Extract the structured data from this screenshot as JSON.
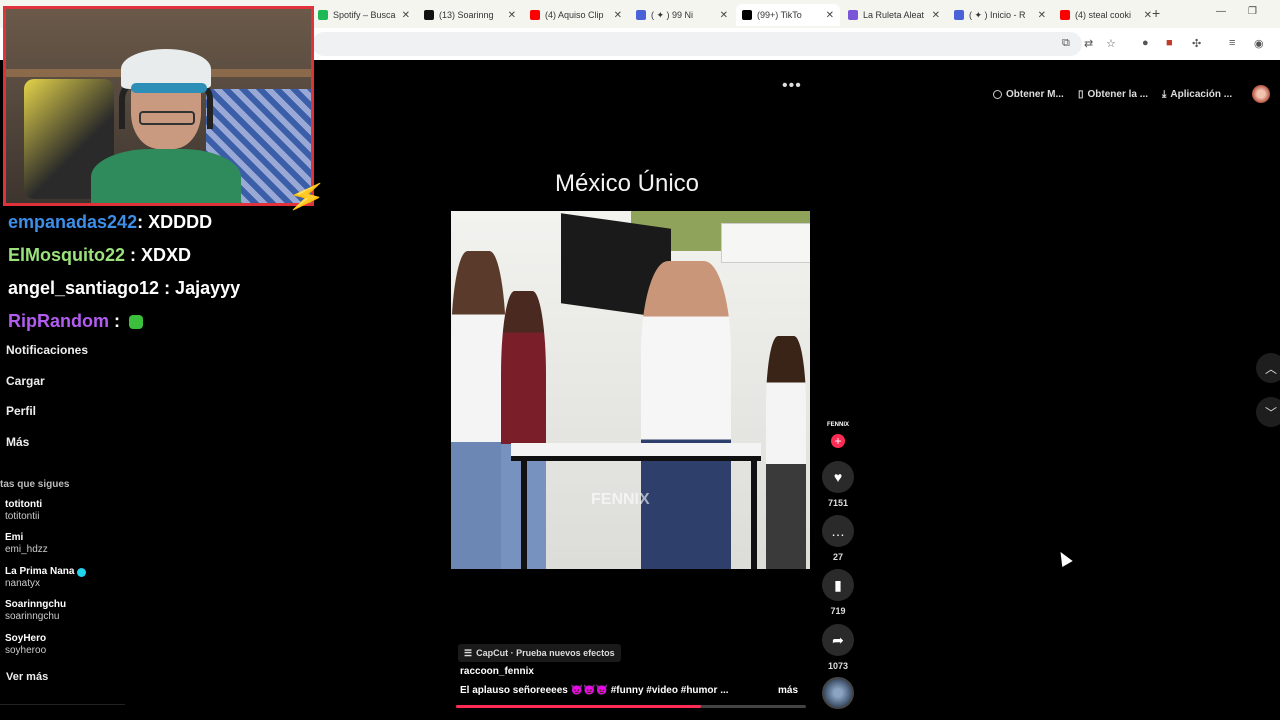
{
  "browser": {
    "tabs": [
      {
        "title": "Spotify – Busca",
        "fav": "#1db954",
        "active": false
      },
      {
        "title": "(13) Soarinng",
        "fav": "#111111",
        "active": false
      },
      {
        "title": "(4) Aquiso Clip",
        "fav": "#ff0000",
        "active": false
      },
      {
        "title": "( ✦ ) 99 Ni",
        "fav": "#4a62d8",
        "active": false
      },
      {
        "title": "(99+) TikTo",
        "fav": "#000000",
        "active": true
      },
      {
        "title": "La Ruleta Aleat",
        "fav": "#7a55d8",
        "active": false
      },
      {
        "title": "( ✦ ) Inicio - R",
        "fav": "#4a62d8",
        "active": false
      },
      {
        "title": "(4) steal cooki",
        "fav": "#ff0000",
        "active": false
      }
    ],
    "new_tab": "+",
    "minimize": "—",
    "restore": "❐"
  },
  "stream_overlay": {
    "chat": [
      {
        "user": "empanadas242",
        "user_color": "#3d8ee8",
        "msg": ": XDDDD"
      },
      {
        "user": "ElMosquito22",
        "user_color": "#9be27a",
        "msg": " : XDXD"
      },
      {
        "user": "angel_santiago12",
        "user_color": "#ffffff",
        "msg": " : Jajayyy"
      },
      {
        "user": "RipRandom",
        "user_color": "#b35cf0",
        "msg": " : "
      }
    ]
  },
  "sidebar": {
    "items": [
      "Notificaciones",
      "Cargar",
      "Perfil",
      "Más"
    ],
    "following_header": "tas que sigues",
    "accounts": [
      {
        "name": "totitonti",
        "handle": "totitontii",
        "verified": false
      },
      {
        "name": "Emi",
        "handle": "emi_hdzz",
        "verified": false
      },
      {
        "name": "La Prima Nana",
        "handle": "nanatyx",
        "verified": true
      },
      {
        "name": "Soarinngchu",
        "handle": "soarinngchu",
        "verified": false
      },
      {
        "name": "SoyHero",
        "handle": "soyheroo",
        "verified": false
      }
    ],
    "see_more": "Ver más"
  },
  "topbar": {
    "more_icon": "•••",
    "get_label_1": "Obtener M...",
    "get_label_2": "Obtener la ...",
    "app_label": "Aplicación ..."
  },
  "video": {
    "title": "México Único",
    "watermark": "FENNIX",
    "creator_logo": "FENNIX",
    "likes": "7151",
    "comments": "27",
    "saves": "719",
    "shares": "1073",
    "effect": "CapCut · Prueba nuevos efectos",
    "author": "raccoon_fennix",
    "caption": "El aplauso señoreeees 👿👿👿 #funny #video #humor ...",
    "more_label": "más",
    "progress": 0.7
  }
}
